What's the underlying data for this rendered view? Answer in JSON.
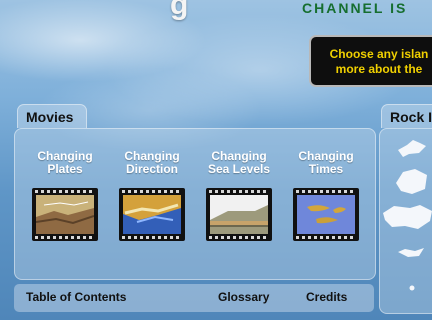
{
  "header": {
    "title_fragment": "g",
    "subtitle": "CHANNEL IS"
  },
  "callout": {
    "line1": "Choose any islan",
    "line2": "more about the"
  },
  "movies": {
    "tab_label": "Movies",
    "items": [
      {
        "title1": "Changing",
        "title2": "Plates"
      },
      {
        "title1": "Changing",
        "title2": "Direction"
      },
      {
        "title1": "Changing",
        "title2": "Sea Levels"
      },
      {
        "title1": "Changing",
        "title2": "Times"
      }
    ]
  },
  "footer": {
    "toc": "Table of Contents",
    "glossary": "Glossary",
    "credits": "Credits"
  },
  "rock_panel": {
    "tab_label": "Rock I"
  }
}
